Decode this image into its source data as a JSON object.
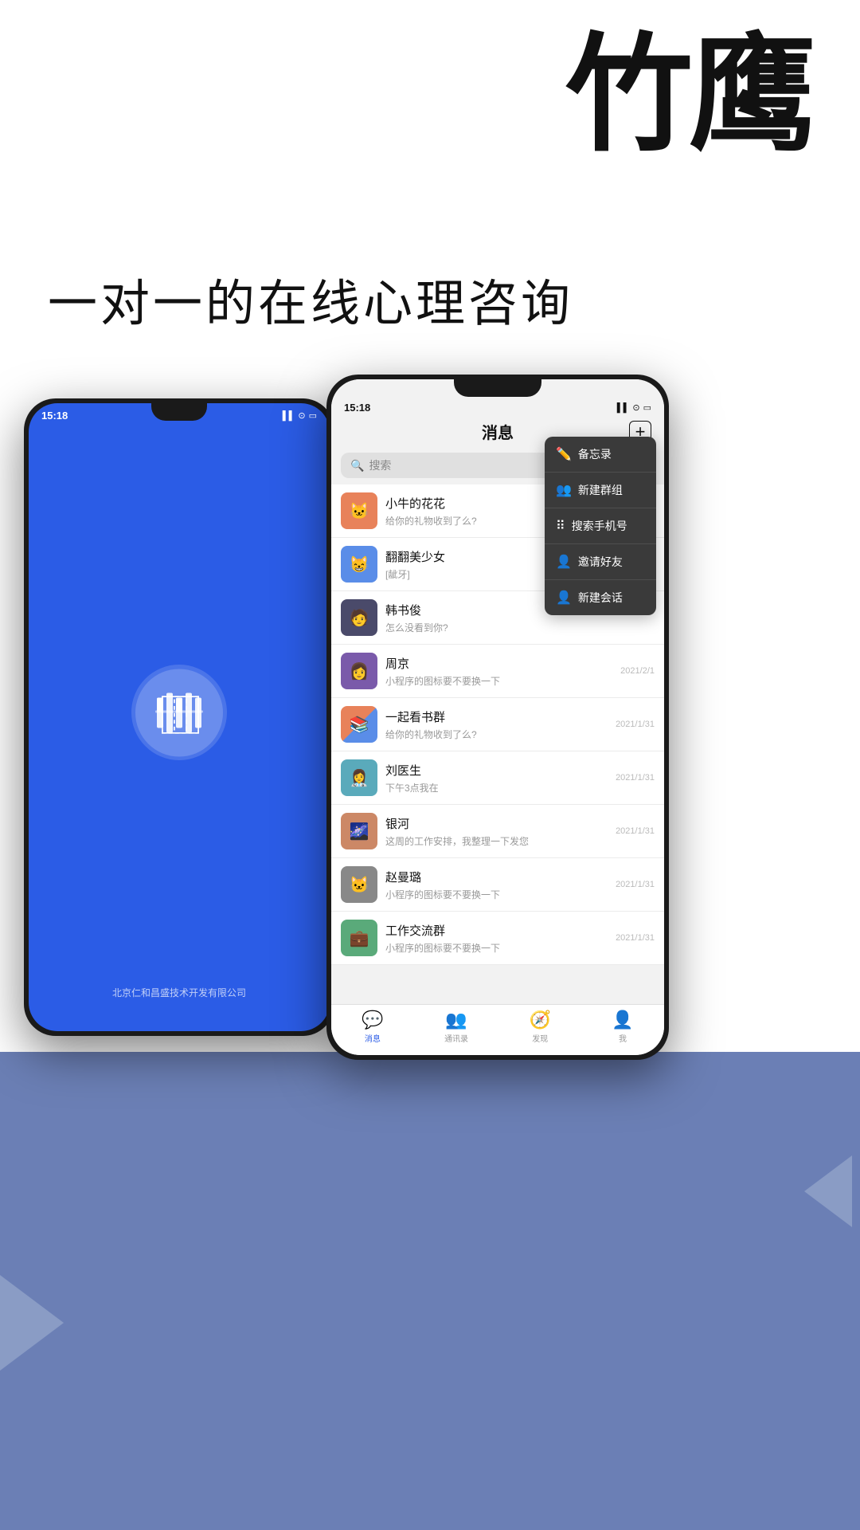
{
  "app": {
    "title": "竹鹰",
    "tagline": "一对一的在线心理咨询",
    "company": "北京仁和昌盛技术开发有限公司"
  },
  "left_phone": {
    "time": "15:18",
    "signal_icons": "▌▌ ⊙ ☐"
  },
  "right_phone": {
    "time": "15:18",
    "header": {
      "title": "消息",
      "plus_label": "+"
    },
    "search": {
      "placeholder": "搜索"
    },
    "dropdown": {
      "items": [
        {
          "icon": "✏️",
          "label": "备忘录"
        },
        {
          "icon": "👥",
          "label": "新建群组"
        },
        {
          "icon": "⠿",
          "label": "搜索手机号"
        },
        {
          "icon": "👤",
          "label": "邀请好友"
        },
        {
          "icon": "👤",
          "label": "新建会话"
        }
      ]
    },
    "messages": [
      {
        "name": "小牛的花花",
        "preview": "给你的礼物收到了么?",
        "time": "",
        "avatar_color": "av-orange",
        "emoji": "🐱"
      },
      {
        "name": "翻翻美少女",
        "preview": "[龇牙]",
        "time": "",
        "avatar_color": "av-blue",
        "emoji": "😸"
      },
      {
        "name": "韩书俊",
        "preview": "怎么没看到你?",
        "time": "",
        "avatar_color": "av-dark",
        "emoji": "🧑"
      },
      {
        "name": "周京",
        "preview": "小程序的图标要不要换一下",
        "time": "2021/2/1",
        "avatar_color": "av-purple",
        "emoji": "👩"
      },
      {
        "name": "一起看书群",
        "preview": "给你的礼物收到了么?",
        "time": "2021/1/31",
        "avatar_color": "av-multi",
        "emoji": "📚"
      },
      {
        "name": "刘医生",
        "preview": "下午3点我在",
        "time": "2021/1/31",
        "avatar_color": "av-teal",
        "emoji": "👩‍⚕️"
      },
      {
        "name": "银河",
        "preview": "这周的工作安排，我整理一下发您",
        "time": "2021/1/31",
        "avatar_color": "av-pink",
        "emoji": "🌌"
      },
      {
        "name": "赵曼璐",
        "preview": "小程序的图标要不要换一下",
        "time": "2021/1/31",
        "avatar_color": "av-gray",
        "emoji": "🐱"
      },
      {
        "name": "工作交流群",
        "preview": "小程序的图标要不要换一下",
        "time": "2021/1/31",
        "avatar_color": "av-green",
        "emoji": "💼"
      }
    ],
    "tabs": [
      {
        "icon": "💬",
        "label": "消息",
        "active": true
      },
      {
        "icon": "👥",
        "label": "通讯录",
        "active": false
      },
      {
        "icon": "🧭",
        "label": "发现",
        "active": false
      },
      {
        "icon": "👤",
        "label": "我",
        "active": false
      }
    ]
  }
}
